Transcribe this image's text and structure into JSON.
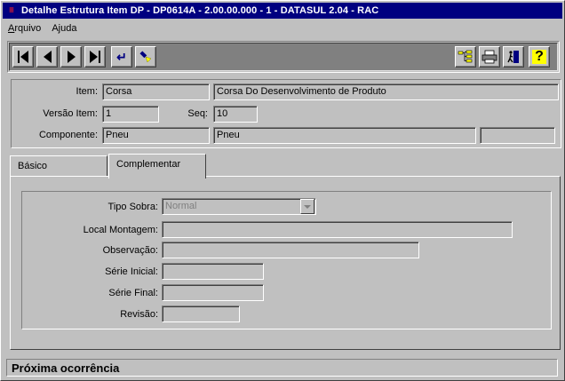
{
  "window": {
    "title": "Detalhe Estrutura Item DP - DP0614A - 2.00.00.000 - 1 - DATASUL 2.04 - RAC",
    "icon_glyph": "≡"
  },
  "menu": {
    "items": [
      {
        "label": "Arquivo"
      },
      {
        "label": "Ajuda"
      }
    ]
  },
  "toolbar": {
    "buttons_left": [
      "first-record-icon",
      "previous-record-icon",
      "next-record-icon",
      "last-record-icon",
      "go-to-icon",
      "search-flashlight-icon"
    ],
    "buttons_right": [
      "tree-structure-icon",
      "print-icon",
      "exit-icon",
      "help-icon"
    ],
    "help_glyph": "?",
    "goto_glyph": "↵"
  },
  "header": {
    "item_label": "Item:",
    "item_code": "Corsa",
    "item_desc": "Corsa Do Desenvolvimento de Produto",
    "versao_label": "Versão Item:",
    "versao_value": "1",
    "seq_label": "Seq:",
    "seq_value": "10",
    "componente_label": "Componente:",
    "componente_code": "Pneu",
    "componente_desc": "Pneu",
    "componente_extra": ""
  },
  "tabs": [
    {
      "label": "Básico",
      "active": false
    },
    {
      "label": "Complementar",
      "active": true
    }
  ],
  "complementar": {
    "tipo_sobra_label": "Tipo Sobra:",
    "tipo_sobra_value": "Normal",
    "local_montagem_label": "Local Montagem:",
    "local_montagem_value": "",
    "observacao_label": "Observação:",
    "observacao_value": "",
    "serie_inicial_label": "Série Inicial:",
    "serie_inicial_value": "",
    "serie_final_label": "Série Final:",
    "serie_final_value": "",
    "revisao_label": "Revisão:",
    "revisao_value": ""
  },
  "status": {
    "text": "Próxima ocorrência"
  },
  "colors": {
    "titlebar": "#000080",
    "face": "#c0c0c0",
    "toolbar_bg": "#808080"
  }
}
